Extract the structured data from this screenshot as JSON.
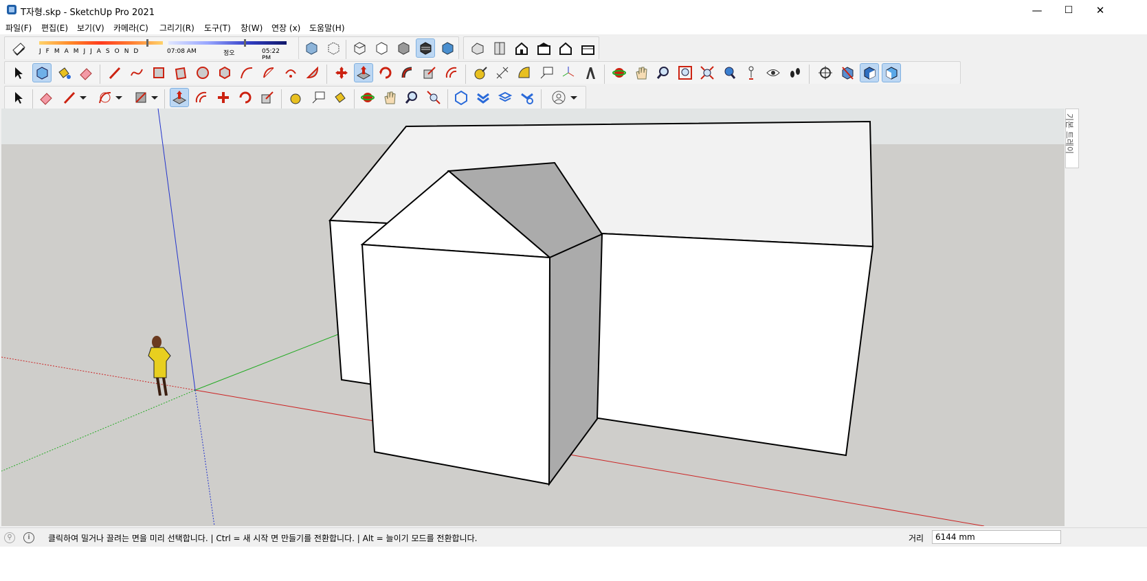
{
  "window": {
    "title": "T자형.skp - SketchUp Pro 2021",
    "minimize": "—",
    "maximize": "☐",
    "close": "✕"
  },
  "menu": [
    {
      "label": "파일(F)"
    },
    {
      "label": "편집(E)"
    },
    {
      "label": "보기(V)"
    },
    {
      "label": "카메라(C)"
    },
    {
      "label": "그리기(R)"
    },
    {
      "label": "도구(T)"
    },
    {
      "label": "창(W)"
    },
    {
      "label": "연장 (x)"
    },
    {
      "label": "도움말(H)"
    }
  ],
  "shadows": {
    "months": [
      "J",
      "F",
      "M",
      "A",
      "M",
      "J",
      "J",
      "A",
      "S",
      "O",
      "N",
      "D"
    ],
    "time_start": "07:08 AM",
    "time_mid": "정오",
    "time_end": "05:22 PM"
  },
  "tray": {
    "tab_label": "기본 트레이"
  },
  "status": {
    "message": "클릭하여 밀거나 끌려는 면을 미리 선택합니다. | Ctrl = 새 시작 면 만들기를 전환합니다. | Alt = 늘이기 모드를 전환합니다.",
    "measure_label": "거리",
    "measure_value": "6144 mm",
    "info_icon": "i"
  },
  "colors": {
    "sky": "#e3e6e6",
    "ground": "#cfcecb",
    "red_axis": "#cc2222",
    "green_axis": "#22aa22",
    "blue_axis": "#2233cc",
    "face_light": "#ffffff",
    "face_shadow": "#ababab",
    "roof_top": "#f2f2f2"
  }
}
